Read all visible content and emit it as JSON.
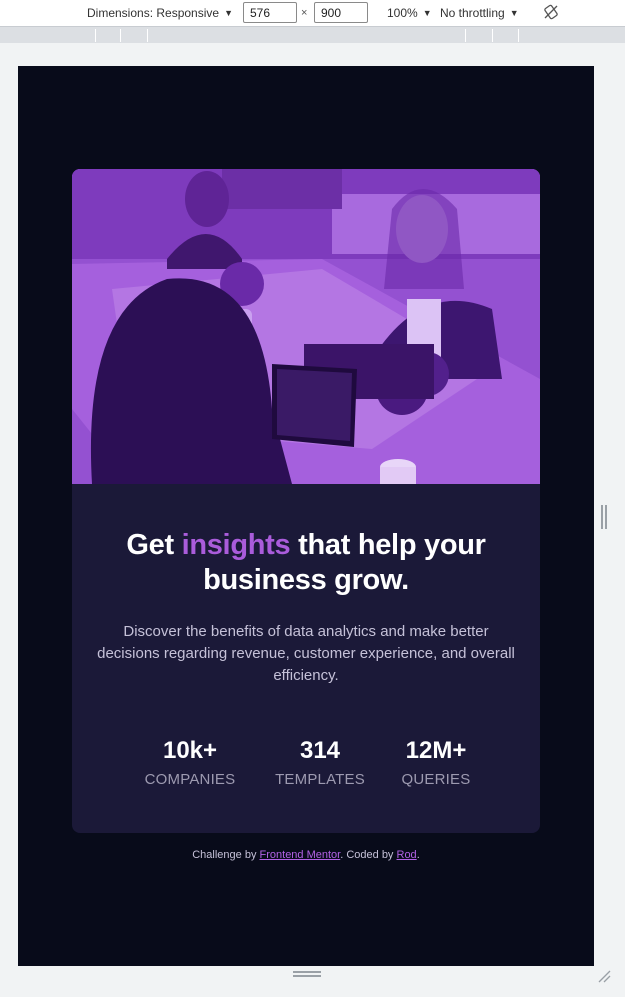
{
  "devtools": {
    "dimensions_label": "Dimensions: Responsive",
    "width_value": "576",
    "height_value": "900",
    "times": "×",
    "zoom": "100%",
    "throttling": "No throttling"
  },
  "card": {
    "title_before": "Get ",
    "title_accent": "insights",
    "title_after": " that help your business grow.",
    "description": "Discover the benefits of data analytics and make better decisions regarding revenue, customer experience, and overall efficiency.",
    "stats": [
      {
        "value": "10k+",
        "label": "COMPANIES"
      },
      {
        "value": "314",
        "label": "TEMPLATES"
      },
      {
        "value": "12M+",
        "label": "QUERIES"
      }
    ]
  },
  "attribution": {
    "prefix": "Challenge by ",
    "link1": "Frontend Mentor",
    "middle": ". Coded by ",
    "link2": "Rod",
    "suffix": "."
  },
  "colors": {
    "page_bg": "#080b1a",
    "card_bg": "#1b1938",
    "accent": "#aa5cdb",
    "hero_tint": "#8a44c9"
  },
  "icons": [
    "caret-down-icon",
    "rotate-icon",
    "resize-corner-icon"
  ]
}
